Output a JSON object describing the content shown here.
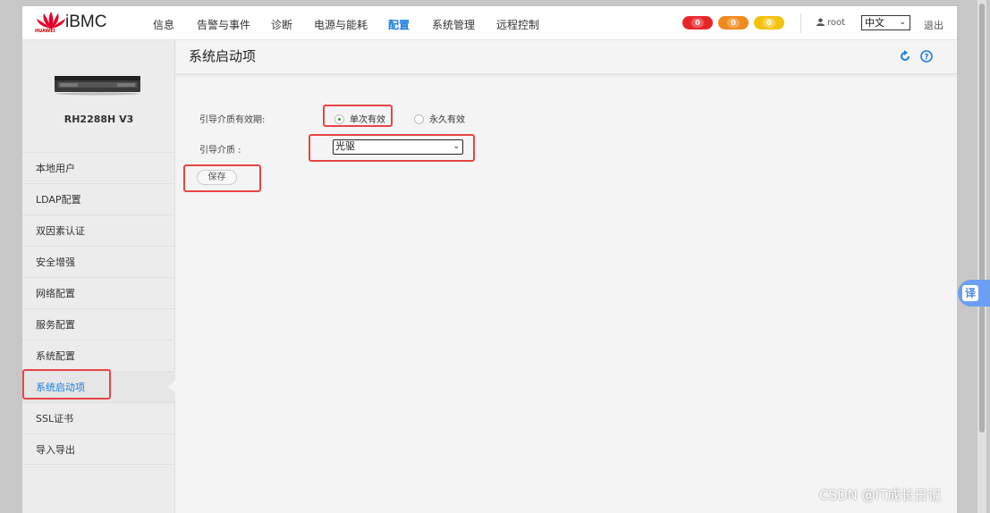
{
  "header": {
    "brand": "iBMC",
    "logo_text": "HUAWEI",
    "nav": [
      "信息",
      "告警与事件",
      "诊断",
      "电源与能耗",
      "配置",
      "系统管理",
      "远程控制"
    ],
    "active_nav": "配置",
    "alerts": [
      {
        "count": "0",
        "color": "#e8262a"
      },
      {
        "count": "0",
        "color": "#f08a1c"
      },
      {
        "count": "0",
        "color": "#f2c20d"
      }
    ],
    "user": "root",
    "language": "中文",
    "logout": "退出"
  },
  "sidebar": {
    "model": "RH2288H V3",
    "items": [
      "本地用户",
      "LDAP配置",
      "双因素认证",
      "安全增强",
      "网络配置",
      "服务配置",
      "系统配置",
      "系统启动项",
      "SSL证书",
      "导入导出"
    ],
    "active_item": "系统启动项"
  },
  "main": {
    "title": "系统启动项",
    "validity_label": "引导介质有效期:",
    "validity_options": [
      "单次有效",
      "永久有效"
    ],
    "validity_selected": "单次有效",
    "media_label": "引导介质 :",
    "media_value": "光驱",
    "save_label": "保存"
  },
  "overlay": {
    "translate_label": "译",
    "watermark": "CSDN @IT成长日记"
  },
  "colors": {
    "accent": "#1a7de0",
    "highlight": "#e64545",
    "radio_dot": "#2c9c3c"
  }
}
